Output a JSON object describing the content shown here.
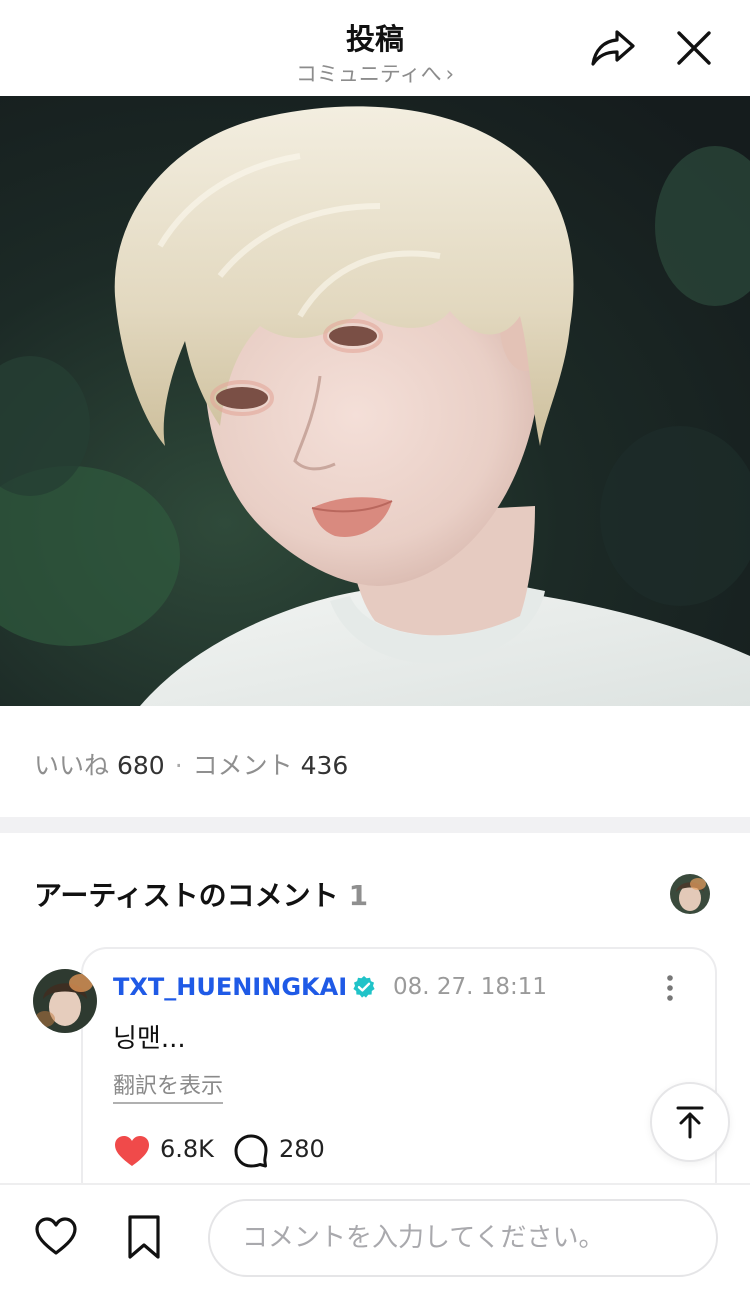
{
  "header": {
    "title": "投稿",
    "subtitle": "コミュニティへ",
    "subtitle_chevron": "›"
  },
  "post": {
    "likes_label": "いいね",
    "likes_count": "680",
    "separator": "·",
    "comments_label": "コメント",
    "comments_count": "436"
  },
  "artist_comments": {
    "title": "アーティストのコメント",
    "count": "1",
    "items": [
      {
        "username": "TXT_HUENINGKAI",
        "verified": true,
        "timestamp": "08. 27. 18:11",
        "text": "닝맨...",
        "translate_label": "翻訳を表示",
        "like_count": "6.8K",
        "reply_count": "280"
      }
    ]
  },
  "bottom_bar": {
    "input_placeholder": "コメントを入力してください。"
  },
  "colors": {
    "accent_blue": "#1f5ae6",
    "verified_teal": "#20c3c8",
    "heart_red": "#f04a4a"
  },
  "icons": [
    "share-icon",
    "close-icon",
    "verified-icon",
    "more-vertical-icon",
    "heart-filled-icon",
    "comment-bubble-icon",
    "scroll-top-icon",
    "heart-outline-icon",
    "bookmark-icon"
  ]
}
